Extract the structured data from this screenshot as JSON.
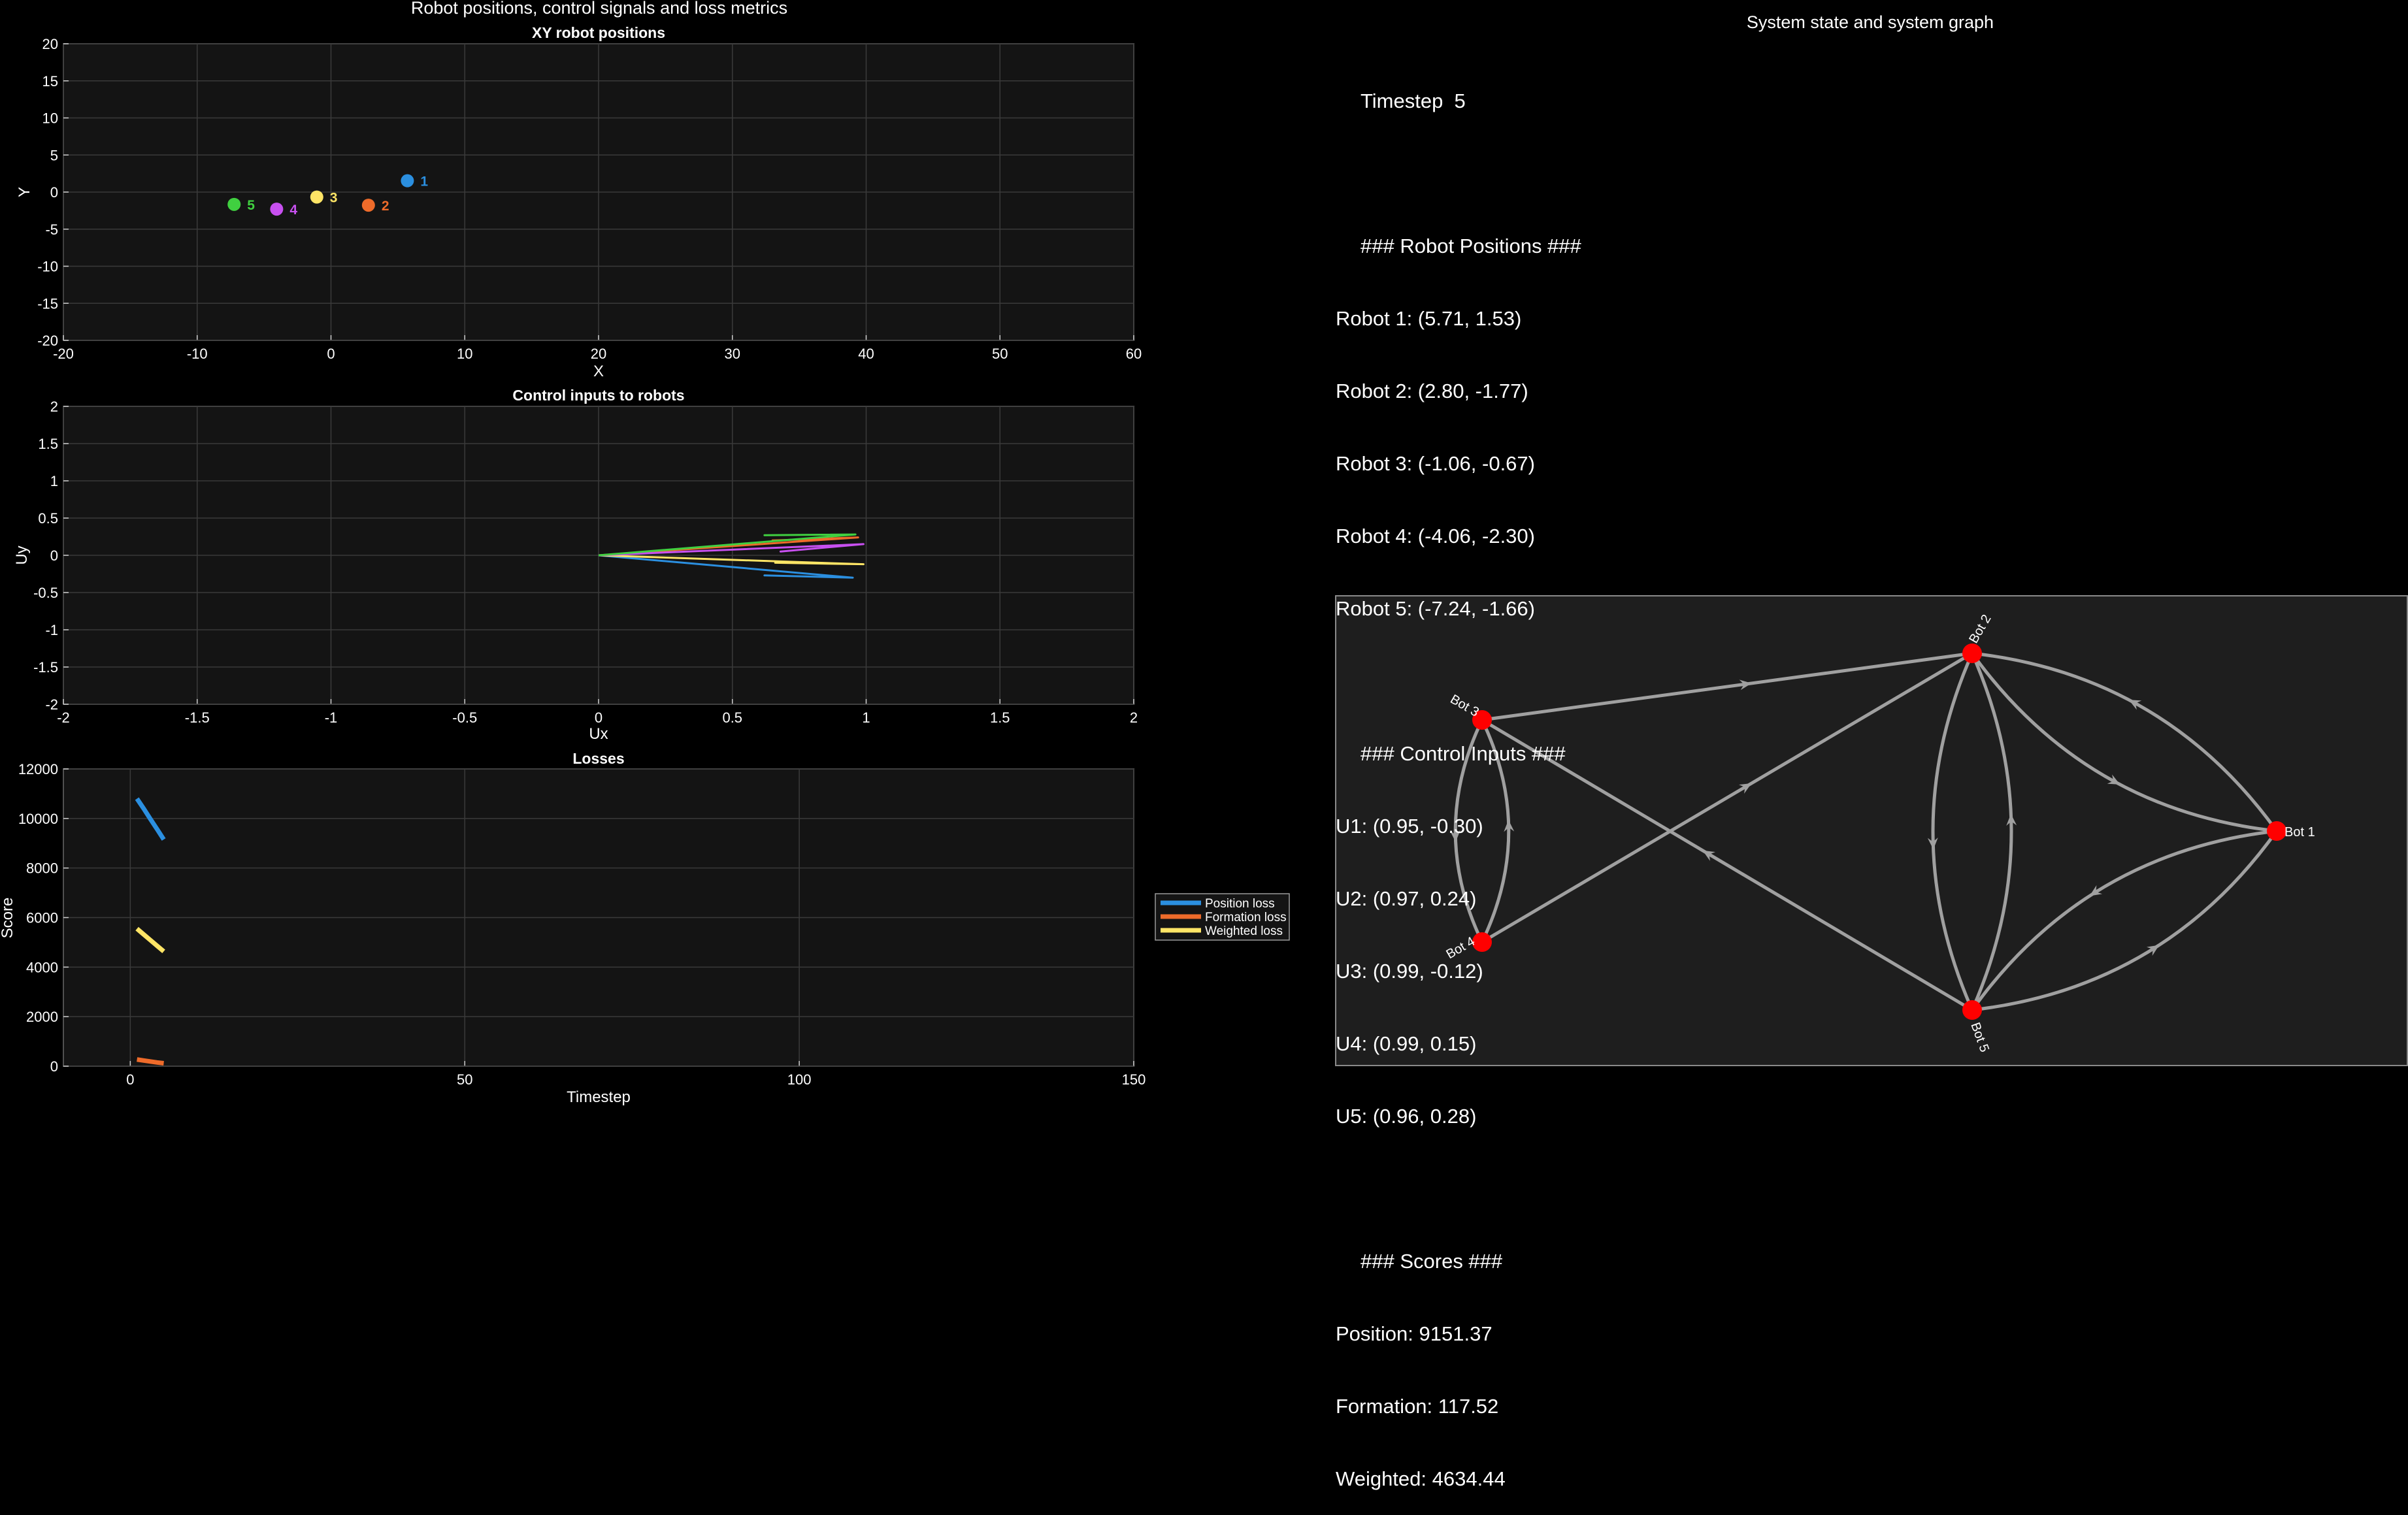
{
  "window_title": "Robot positions, control signals and loss metrics",
  "right_title": "System state and system graph",
  "xy_plot": {
    "title": "XY robot positions",
    "xlabel": "X",
    "ylabel": "Y",
    "xlim": [
      -20,
      60
    ],
    "ylim": [
      -20,
      20
    ],
    "xticks": [
      "-20",
      "-10",
      "0",
      "10",
      "20",
      "30",
      "40",
      "50",
      "60"
    ],
    "yticks": [
      "-20",
      "-15",
      "-10",
      "-5",
      "0",
      "5",
      "10",
      "15",
      "20"
    ]
  },
  "control_plot": {
    "title": "Control inputs to robots",
    "xlabel": "Ux",
    "ylabel": "Uy",
    "xlim": [
      -2,
      2
    ],
    "ylim": [
      -2,
      2
    ],
    "xticks": [
      "-2",
      "-1.5",
      "-1",
      "-0.5",
      "0",
      "0.5",
      "1",
      "1.5",
      "2"
    ],
    "yticks": [
      "-2",
      "-1.5",
      "-1",
      "-0.5",
      "0",
      "0.5",
      "1",
      "1.5",
      "2"
    ]
  },
  "loss_plot": {
    "title": "Losses",
    "xlabel": "Timestep",
    "ylabel": "Score",
    "xlim": [
      -10,
      150
    ],
    "ylim": [
      0,
      12000
    ],
    "xticks": [
      "0",
      "50",
      "100",
      "150"
    ],
    "yticks": [
      "0",
      "2000",
      "4000",
      "6000",
      "8000",
      "10000",
      "12000"
    ],
    "legend": [
      "Position loss",
      "Formation loss",
      "Weighted loss"
    ]
  },
  "chart_data": [
    {
      "type": "scatter",
      "title": "XY robot positions",
      "xlabel": "X",
      "ylabel": "Y",
      "xlim": [
        -20,
        60
      ],
      "ylim": [
        -20,
        20
      ],
      "grid": true,
      "points": [
        {
          "label": "1",
          "x": 5.71,
          "y": 1.53,
          "color": "#2b8fe0"
        },
        {
          "label": "2",
          "x": 2.8,
          "y": -1.77,
          "color": "#ee6b2a"
        },
        {
          "label": "3",
          "x": -1.06,
          "y": -0.67,
          "color": "#ffe566"
        },
        {
          "label": "4",
          "x": -4.06,
          "y": -2.3,
          "color": "#c850f0"
        },
        {
          "label": "5",
          "x": -7.24,
          "y": -1.66,
          "color": "#40d040"
        }
      ]
    },
    {
      "type": "line",
      "title": "Control inputs to robots",
      "xlabel": "Ux",
      "ylabel": "Uy",
      "xlim": [
        -2,
        2
      ],
      "ylim": [
        -2,
        2
      ],
      "grid": true,
      "series": [
        {
          "color": "#2b8fe0",
          "points": [
            [
              0,
              0
            ],
            [
              0.95,
              -0.3
            ],
            [
              0.62,
              -0.27
            ],
            [
              0.95,
              -0.3
            ]
          ]
        },
        {
          "color": "#ee6b2a",
          "points": [
            [
              0,
              0
            ],
            [
              0.97,
              0.24
            ],
            [
              0.65,
              0.2
            ],
            [
              0.97,
              0.24
            ]
          ]
        },
        {
          "color": "#ffe566",
          "points": [
            [
              0,
              0
            ],
            [
              0.99,
              -0.12
            ],
            [
              0.66,
              -0.1
            ],
            [
              0.99,
              -0.12
            ]
          ]
        },
        {
          "color": "#c850f0",
          "points": [
            [
              0,
              0
            ],
            [
              0.99,
              0.15
            ],
            [
              0.68,
              0.05
            ],
            [
              0.99,
              0.15
            ]
          ]
        },
        {
          "color": "#40d040",
          "points": [
            [
              0,
              0
            ],
            [
              0.96,
              0.28
            ],
            [
              0.62,
              0.27
            ],
            [
              0.96,
              0.28
            ]
          ]
        }
      ]
    },
    {
      "type": "line",
      "title": "Losses",
      "xlabel": "Timestep",
      "ylabel": "Score",
      "xlim": [
        -10,
        150
      ],
      "ylim": [
        0,
        12000
      ],
      "legend_position": "outside-right",
      "grid": true,
      "series": [
        {
          "name": "Position loss",
          "color": "#2b8fe0",
          "x": [
            1,
            2,
            3,
            4,
            5
          ],
          "values": [
            10800,
            10400,
            9980,
            9570,
            9151
          ]
        },
        {
          "name": "Formation loss",
          "color": "#ee6b2a",
          "x": [
            1,
            2,
            3,
            4,
            5
          ],
          "values": [
            270,
            230,
            190,
            150,
            118
          ]
        },
        {
          "name": "Weighted loss",
          "color": "#ffe566",
          "x": [
            1,
            2,
            3,
            4,
            5
          ],
          "values": [
            5550,
            5320,
            5090,
            4860,
            4634
          ]
        }
      ]
    }
  ],
  "state_panel": {
    "timestep": "Timestep  5",
    "positions_header": "### Robot Positions ###",
    "positions": [
      "Robot 1: (5.71, 1.53)",
      "Robot 2: (2.80, -1.77)",
      "Robot 3: (-1.06, -0.67)",
      "Robot 4: (-4.06, -2.30)",
      "Robot 5: (-7.24, -1.66)"
    ],
    "controls_header": "### Control Inputs ###",
    "controls": [
      "U1: (0.95, -0.30)",
      "U2: (0.97, 0.24)",
      "U3: (0.99, -0.12)",
      "U4: (0.99, 0.15)",
      "U5: (0.96, 0.28)"
    ],
    "scores_header": "### Scores ###",
    "scores": [
      "Position: 9151.37",
      "Formation: 117.52",
      "Weighted: 4634.44"
    ]
  },
  "graph": {
    "node_color": "#ff0000",
    "edge_color": "#a0a0a0",
    "nodes": [
      {
        "id": "bot1",
        "label": "Bot 1"
      },
      {
        "id": "bot2",
        "label": "Bot 2"
      },
      {
        "id": "bot3",
        "label": "Bot 3"
      },
      {
        "id": "bot4",
        "label": "Bot 4"
      },
      {
        "id": "bot5",
        "label": "Bot 5"
      }
    ],
    "edges": [
      {
        "from": "bot3",
        "to": "bot2"
      },
      {
        "from": "bot4",
        "to": "bot2"
      },
      {
        "from": "bot5",
        "to": "bot3"
      },
      {
        "from": "bot3",
        "to": "bot4"
      },
      {
        "from": "bot4",
        "to": "bot3"
      },
      {
        "from": "bot2",
        "to": "bot5"
      },
      {
        "from": "bot5",
        "to": "bot2"
      },
      {
        "from": "bot2",
        "to": "bot1"
      },
      {
        "from": "bot1",
        "to": "bot2"
      },
      {
        "from": "bot5",
        "to": "bot1"
      },
      {
        "from": "bot1",
        "to": "bot5"
      }
    ]
  },
  "colors": {
    "background": "#000000",
    "axes_bg": "#141414",
    "grid": "#3a3a3a",
    "text": "#ffffff",
    "graph_bg": "#1e1e1e"
  }
}
